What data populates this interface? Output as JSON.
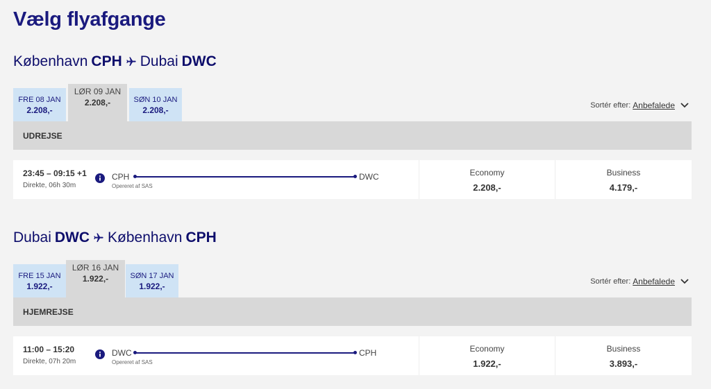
{
  "page_title": "Vælg flyafgange",
  "sort_label": "Sortér efter:",
  "sort_value": "Anbefalede",
  "operated_by": "Opereret af SAS",
  "outbound": {
    "origin_city": "København",
    "origin_code": "CPH",
    "dest_city": "Dubai",
    "dest_code": "DWC",
    "dates": [
      {
        "date": "FRE 08 JAN",
        "price": "2.208,-"
      },
      {
        "date": "LØR 09 JAN",
        "price": "2.208,-"
      },
      {
        "date": "SØN 10 JAN",
        "price": "2.208,-"
      }
    ],
    "direction_label": "UDREJSE",
    "flight": {
      "times": "23:45 – 09:15 +1",
      "duration": "Direkte, 06h 30m",
      "from": "CPH",
      "to": "DWC",
      "economy_label": "Economy",
      "economy_price": "2.208,-",
      "business_label": "Business",
      "business_price": "4.179,-"
    }
  },
  "return": {
    "origin_city": "Dubai",
    "origin_code": "DWC",
    "dest_city": "København",
    "dest_code": "CPH",
    "dates": [
      {
        "date": "FRE 15 JAN",
        "price": "1.922,-"
      },
      {
        "date": "LØR 16 JAN",
        "price": "1.922,-"
      },
      {
        "date": "SØN 17 JAN",
        "price": "1.922,-"
      }
    ],
    "direction_label": "HJEMREJSE",
    "flight": {
      "times": "11:00 – 15:20",
      "duration": "Direkte, 07h 20m",
      "from": "DWC",
      "to": "CPH",
      "economy_label": "Economy",
      "economy_price": "1.922,-",
      "business_label": "Business",
      "business_price": "3.893,-"
    }
  },
  "colors": {
    "brand": "#1a1a7e",
    "tab_blue": "#cfe3f5",
    "tab_selected": "#d8d8d8"
  }
}
